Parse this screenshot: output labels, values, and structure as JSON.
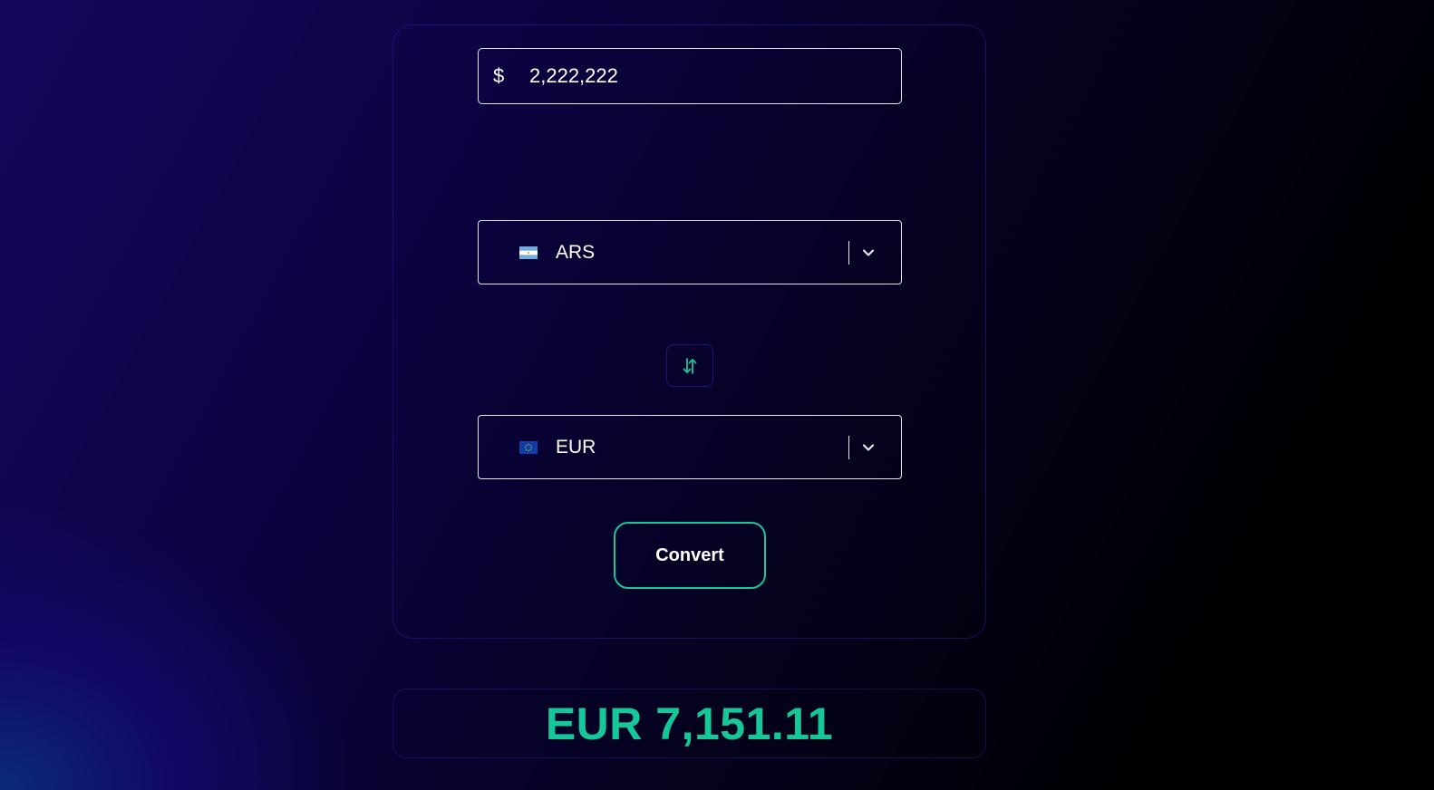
{
  "converter": {
    "amount": {
      "symbol": "$",
      "value": "2,222,222"
    },
    "from": {
      "code": "ARS",
      "flag_icon": "argentina-flag-icon"
    },
    "swap_icon": "swap-arrows-icon",
    "to": {
      "code": "EUR",
      "flag_icon": "eu-flag-icon"
    },
    "convert_label": "Convert"
  },
  "result": {
    "text": "EUR 7,151.11"
  },
  "colors": {
    "accent": "#16c79a",
    "border": "#e6e6ef"
  }
}
